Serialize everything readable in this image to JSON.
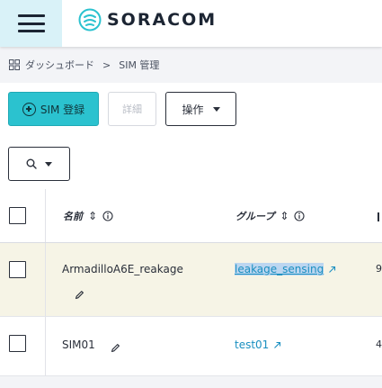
{
  "app": {
    "brand": "SORACOM",
    "brand_color": "#2bc2cf"
  },
  "breadcrumb": {
    "home": "ダッシュボード",
    "separator": ">",
    "current": "SIM 管理"
  },
  "toolbar": {
    "register_label": "SIM 登録",
    "detail_label": "詳細",
    "action_label": "操作"
  },
  "table": {
    "columns": {
      "name": "名前",
      "group": "グループ"
    },
    "rows": [
      {
        "name": "ArmadilloA6E_reakage",
        "group": "leakage_sensing",
        "extra": "9"
      },
      {
        "name": "SIM01",
        "group": "test01",
        "extra": "4"
      }
    ]
  }
}
